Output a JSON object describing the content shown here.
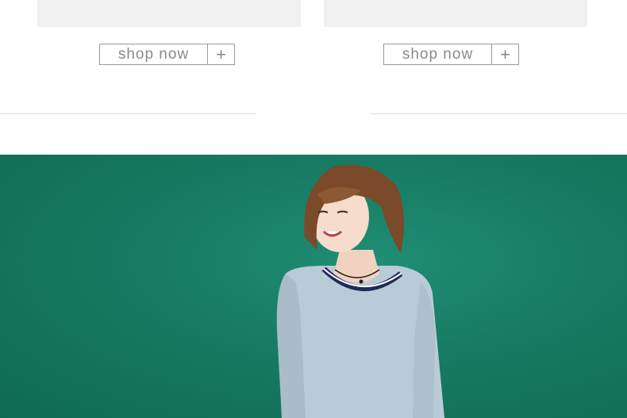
{
  "product_cards": [
    {
      "shop_label": "shop now",
      "plus_icon": "plus-icon"
    },
    {
      "shop_label": "shop now",
      "plus_icon": "plus-icon"
    }
  ],
  "hero": {
    "background_color": "#177a62",
    "subject_icon": "model-photo"
  }
}
